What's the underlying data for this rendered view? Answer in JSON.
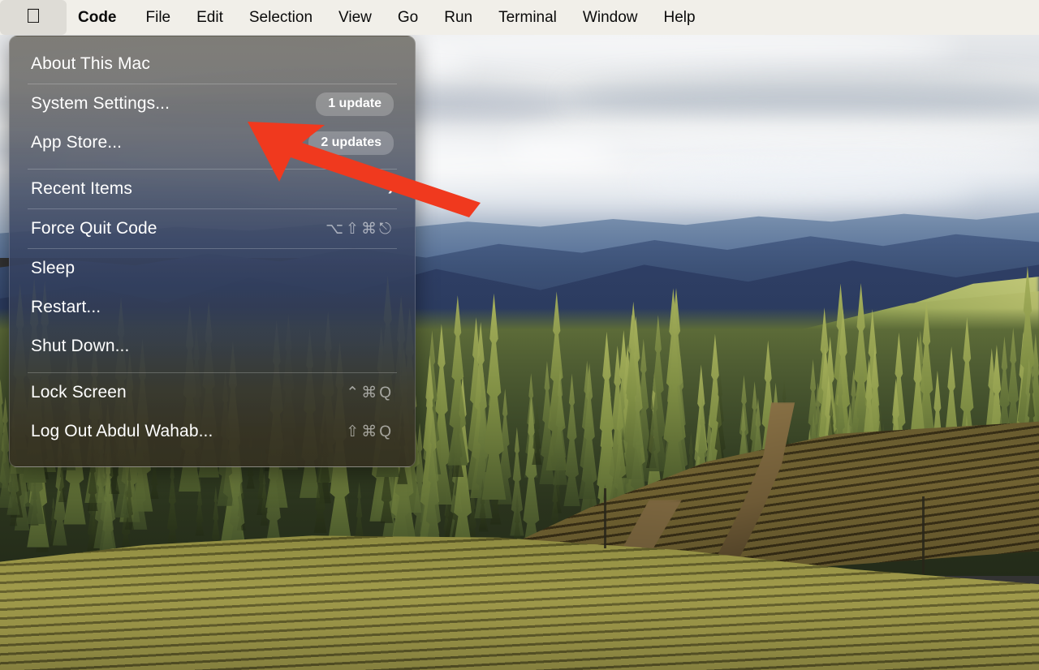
{
  "menubar": {
    "apple_icon": "apple-logo-icon",
    "items": [
      {
        "label": "Code",
        "bold": true
      },
      {
        "label": "File",
        "bold": false
      },
      {
        "label": "Edit",
        "bold": false
      },
      {
        "label": "Selection",
        "bold": false
      },
      {
        "label": "View",
        "bold": false
      },
      {
        "label": "Go",
        "bold": false
      },
      {
        "label": "Run",
        "bold": false
      },
      {
        "label": "Terminal",
        "bold": false
      },
      {
        "label": "Window",
        "bold": false
      },
      {
        "label": "Help",
        "bold": false
      }
    ]
  },
  "apple_menu": {
    "items": {
      "about": {
        "label": "About This Mac"
      },
      "system_settings": {
        "label": "System Settings...",
        "badge": "1 update"
      },
      "app_store": {
        "label": "App Store...",
        "badge": "2 updates"
      },
      "recent_items": {
        "label": "Recent Items",
        "submenu_icon": "chevron-right-icon"
      },
      "force_quit": {
        "label": "Force Quit Code",
        "shortcut": "⌥⇧⌘⎋"
      },
      "sleep": {
        "label": "Sleep"
      },
      "restart": {
        "label": "Restart..."
      },
      "shut_down": {
        "label": "Shut Down..."
      },
      "lock_screen": {
        "label": "Lock Screen",
        "shortcut": "⌃⌘Q"
      },
      "log_out": {
        "label": "Log Out Abdul Wahab...",
        "shortcut": "⇧⌘Q"
      }
    }
  },
  "annotation": {
    "arrow_color": "#F0391E",
    "arrow_name": "red-pointer-arrow",
    "points_at": "System Settings..."
  },
  "colors": {
    "menubar_bg": "#F1EFE9",
    "menubar_text": "#0A0A0A",
    "apple_highlight": "#DEDCD6",
    "menu_text": "#FFFFFF",
    "badge_bg": "#7D7D7B"
  }
}
